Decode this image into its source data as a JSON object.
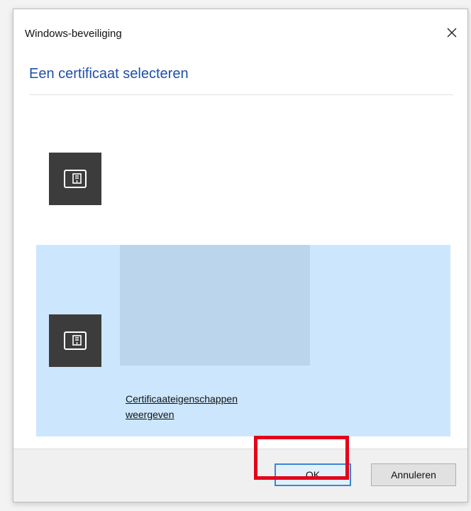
{
  "window": {
    "title": "Windows-beveiliging",
    "close_icon": "close-icon"
  },
  "dialog": {
    "heading": "Een certificaat selecteren"
  },
  "certificates": [
    {
      "icon": "certificate-icon",
      "selected": false
    },
    {
      "icon": "certificate-icon",
      "selected": true,
      "link_text": "Certificaateigenschappen weergeven"
    }
  ],
  "footer": {
    "ok_label": "OK",
    "cancel_label": "Annuleren"
  },
  "colors": {
    "heading": "#1f4fa8",
    "selected_row": "#cce7fd",
    "redacted_details": "#bad5ec",
    "icon_tile": "#3c3c3c",
    "highlight": "#e4001b",
    "ok_border": "#3a86d7"
  }
}
